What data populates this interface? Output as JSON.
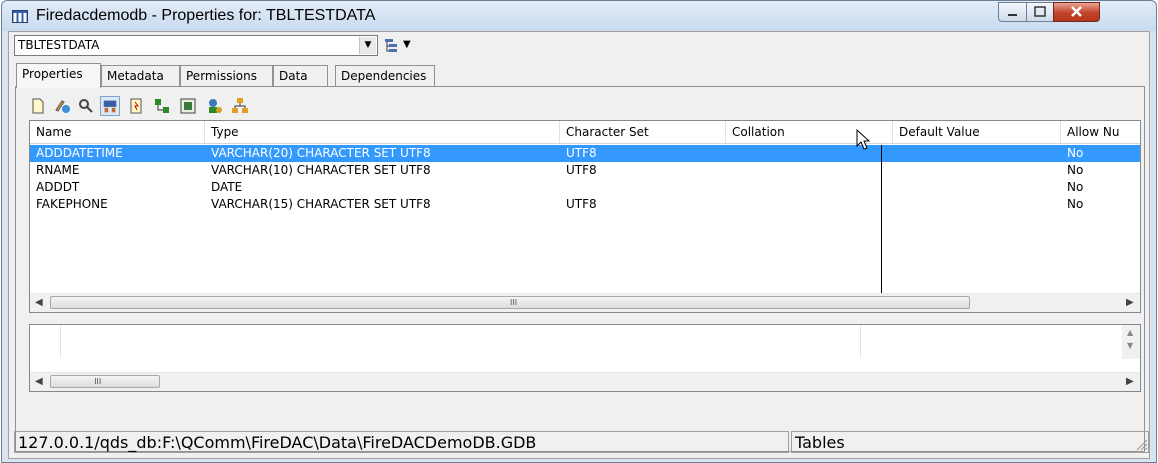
{
  "window": {
    "title": "Firedacdemodb - Properties for: TBLTESTDATA",
    "controls": {
      "minimize": "minimize",
      "maximize": "maximize",
      "close": "close"
    }
  },
  "toolbar": {
    "object_combo_value": "TBLTESTDATA",
    "layout_icon": "tree-layout-icon"
  },
  "tabs": [
    {
      "label": "Properties",
      "active": true
    },
    {
      "label": "Metadata",
      "active": false
    },
    {
      "label": "Permissions",
      "active": false
    },
    {
      "label": "Data",
      "active": false
    },
    {
      "label": "Dependencies",
      "active": false
    }
  ],
  "panel_icons": [
    "new-field-icon",
    "edit-field-icon",
    "find-icon",
    "fields-view-icon",
    "triggers-icon",
    "indices-icon",
    "constraints-icon",
    "grants-icon",
    "dependencies-icon"
  ],
  "fields_grid": {
    "columns": [
      "Name",
      "Type",
      "Character Set",
      "Collation",
      "Default Value",
      "Allow Nu"
    ],
    "rows": [
      {
        "name": "ADDDATETIME",
        "type": "VARCHAR(20) CHARACTER SET UTF8",
        "charset": "UTF8",
        "collation": "",
        "default": "",
        "allow_null": "No",
        "selected": true
      },
      {
        "name": "RNAME",
        "type": "VARCHAR(10) CHARACTER SET UTF8",
        "charset": "UTF8",
        "collation": "",
        "default": "",
        "allow_null": "No",
        "selected": false
      },
      {
        "name": "ADDDT",
        "type": "DATE",
        "charset": "",
        "collation": "",
        "default": "",
        "allow_null": "No",
        "selected": false
      },
      {
        "name": "FAKEPHONE",
        "type": "VARCHAR(15) CHARACTER SET UTF8",
        "charset": "UTF8",
        "collation": "",
        "default": "",
        "allow_null": "No",
        "selected": false
      }
    ],
    "scrollbar_grip": "III"
  },
  "lower_grid": {
    "scrollbar_grip": "III"
  },
  "statusbar": {
    "path": "127.0.0.1/qds_db:F:\\QComm\\FireDAC\\Data\\FireDACDemoDB.GDB",
    "section": "Tables"
  },
  "colors": {
    "selection": "#3399ff",
    "titlebar": "#c9daee",
    "close_button": "#c2432a"
  }
}
